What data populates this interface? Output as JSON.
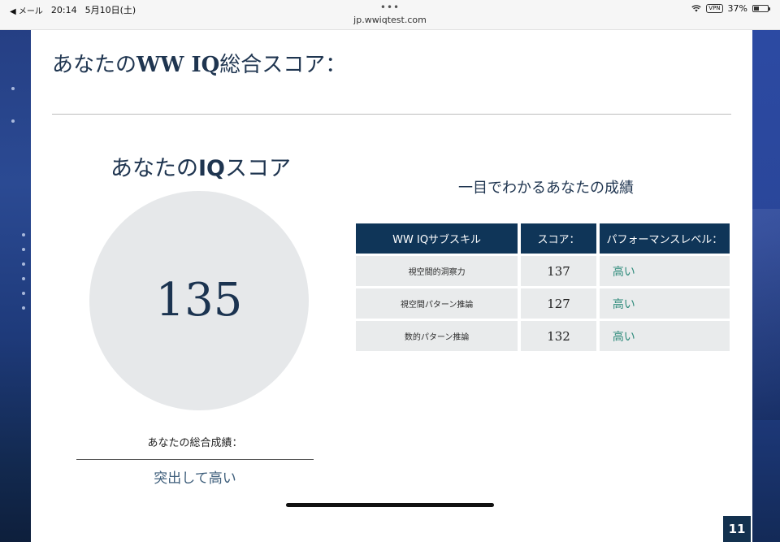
{
  "status_bar": {
    "back_label": "◀ メール",
    "time": "20:14",
    "date": "5月10日(土)",
    "more_dots": "•••",
    "url": "jp.wwiqtest.com",
    "vpn": "VPN",
    "battery_percent": "37%",
    "battery_level": 0.37
  },
  "slide": {
    "title_prefix": "あなたの",
    "title_bold": "WW IQ",
    "title_suffix": "総合スコア：",
    "iq_heading_prefix": "あなたの",
    "iq_heading_bold": "IQ",
    "iq_heading_suffix": "スコア",
    "iq_score": "135",
    "overall_label": "あなたの総合成績：",
    "overall_value": "突出して高い",
    "table_title": "一目でわかるあなたの成績",
    "table": {
      "headers": [
        "WW IQサブスキル",
        "スコア：",
        "パフォーマンスレベル："
      ],
      "rows": [
        {
          "skill": "視空間的洞察力",
          "score": "137",
          "level": "高い"
        },
        {
          "skill": "視空間パターン推論",
          "score": "127",
          "level": "高い"
        },
        {
          "skill": "数的パターン推論",
          "score": "132",
          "level": "高い"
        }
      ]
    },
    "page_number": "11"
  },
  "colors": {
    "heading": "#1f3550",
    "table_header": "#0f3558",
    "cell_bg": "#e9ebec",
    "level_text": "#2d8a7a",
    "circle_bg": "#e6e8ea"
  }
}
